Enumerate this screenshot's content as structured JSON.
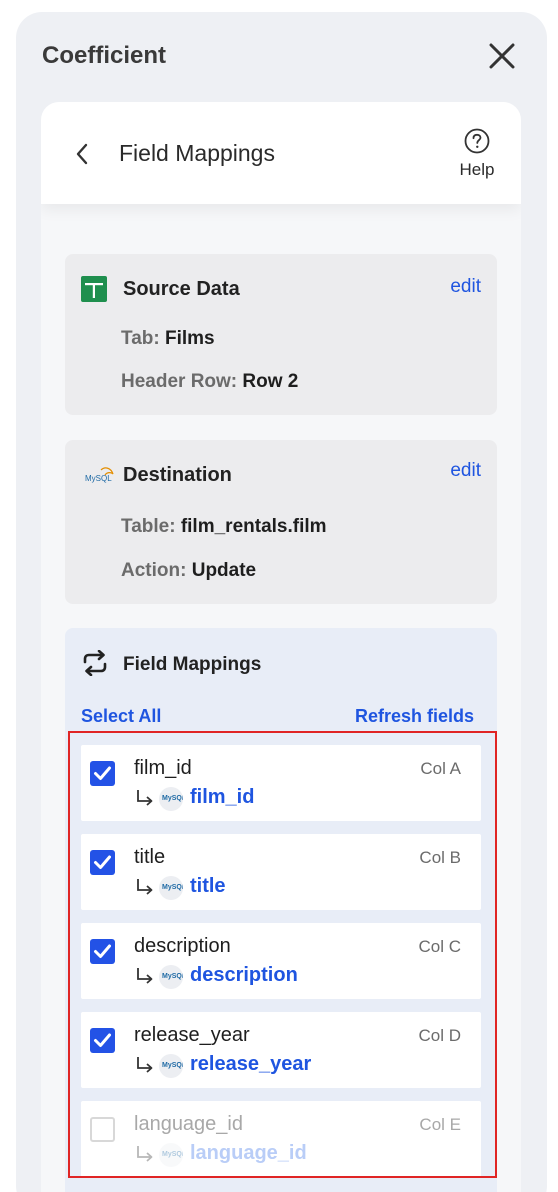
{
  "app": {
    "title": "Coefficient"
  },
  "header": {
    "title": "Field Mappings",
    "help_label": "Help"
  },
  "source": {
    "title": "Source Data",
    "edit_label": "edit",
    "tab_key": "Tab:",
    "tab_value": "Films",
    "header_row_key": "Header Row:",
    "header_row_value": "Row 2"
  },
  "destination": {
    "title": "Destination",
    "edit_label": "edit",
    "badge_text": "MySQL",
    "table_key": "Table:",
    "table_value": "film_rentals.film",
    "action_key": "Action:",
    "action_value": "Update"
  },
  "mappings": {
    "title": "Field Mappings",
    "select_all_label": "Select All",
    "refresh_label": "Refresh fields",
    "rows": [
      {
        "field": "film_id",
        "col": "Col A",
        "mapped": "film_id",
        "checked": true
      },
      {
        "field": "title",
        "col": "Col B",
        "mapped": "title",
        "checked": true
      },
      {
        "field": "description",
        "col": "Col C",
        "mapped": "description",
        "checked": true
      },
      {
        "field": "release_year",
        "col": "Col D",
        "mapped": "release_year",
        "checked": true
      },
      {
        "field": "language_id",
        "col": "Col E",
        "mapped": "language_id",
        "checked": false
      }
    ]
  },
  "colors": {
    "accent": "#1f55e0",
    "checkbox": "#2352e6",
    "highlight": "#e02525",
    "sheets_green": "#1f8f4e"
  }
}
